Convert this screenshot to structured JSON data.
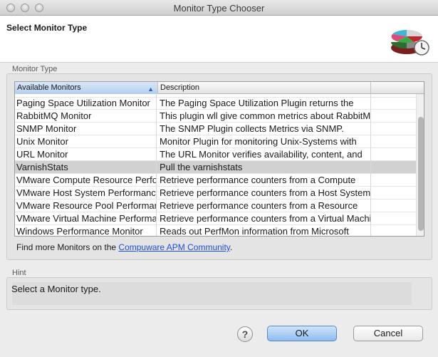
{
  "window": {
    "title": "Monitor Type Chooser"
  },
  "header": {
    "title": "Select Monitor Type",
    "icon": "pie-chart-clock-icon"
  },
  "monitor_group": {
    "label": "Monitor Type",
    "columns": [
      "Available Monitors",
      "Description",
      ""
    ],
    "rows": [
      {
        "name": "Paging Space Utilization Monitor",
        "description": "The Paging Space Utilization Plugin returns the"
      },
      {
        "name": "RabbitMQ Monitor",
        "description": "This plugin wll give common metrics about RabbitMQ"
      },
      {
        "name": "SNMP Monitor",
        "description": "The SNMP Plugin collects Metrics via SNMP."
      },
      {
        "name": "Unix Monitor",
        "description": "Monitor Plugin for monitoring Unix-Systems with"
      },
      {
        "name": "URL Monitor",
        "description": "The URL Monitor verifies availability, content, and"
      },
      {
        "name": "VarnishStats",
        "description": "Pull the varnishstats",
        "selected": true
      },
      {
        "name": "VMware Compute Resource Performance",
        "description": "Retrieve performance counters from a Compute"
      },
      {
        "name": "VMware Host System Performance",
        "description": "Retrieve performance counters from a Host System"
      },
      {
        "name": "VMware Resource Pool Performance",
        "description": "Retrieve performance counters from a Resource"
      },
      {
        "name": "VMware Virtual Machine Performance",
        "description": "Retrieve performance counters from a Virtual Machine"
      },
      {
        "name": "Windows Performance Monitor",
        "description": "Reads out PerfMon information from Microsoft"
      }
    ],
    "find_more_prefix": "Find more Monitors on the ",
    "find_more_link": "Compuware APM Community",
    "find_more_suffix": "."
  },
  "hint_group": {
    "label": "Hint",
    "text": "Select a Monitor type."
  },
  "footer": {
    "help": "?",
    "ok_label": "OK",
    "cancel_label": "Cancel"
  },
  "colors": {
    "selection": "#d1d1d1",
    "link": "#1f4ed8",
    "ok_button": "#8ebcf0"
  }
}
